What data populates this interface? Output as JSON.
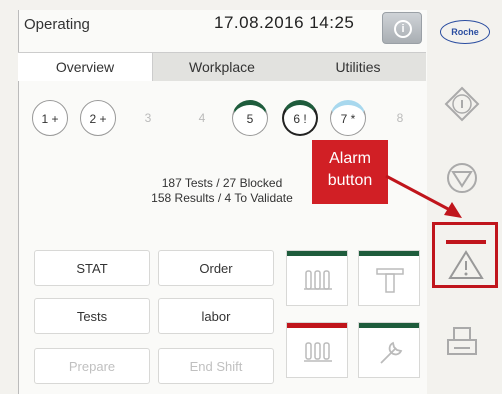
{
  "header": {
    "status": "Operating",
    "datetime": "17.08.2016 14:25",
    "logo_text": "Roche"
  },
  "tabs": [
    {
      "label": "Overview"
    },
    {
      "label": "Workplace"
    },
    {
      "label": "Utilities"
    }
  ],
  "racks": [
    {
      "label": "1 +"
    },
    {
      "label": "2 +"
    },
    {
      "label": "3"
    },
    {
      "label": "4"
    },
    {
      "label": "5"
    },
    {
      "label": "6 !"
    },
    {
      "label": "7 *"
    },
    {
      "label": "8"
    }
  ],
  "summary": {
    "line1": "187 Tests / 27 Blocked",
    "line2": "158 Results / 4 To Validate"
  },
  "buttons": {
    "stat": "STAT",
    "order": "Order",
    "tests": "Tests",
    "labor": "labor",
    "prepare": "Prepare",
    "end_shift": "End Shift"
  },
  "callout": {
    "line1": "Alarm",
    "line2": "button"
  },
  "colors": {
    "accent_red": "#c0151c",
    "status_green": "#1e5c3c",
    "light_blue": "#a8d8ee"
  }
}
